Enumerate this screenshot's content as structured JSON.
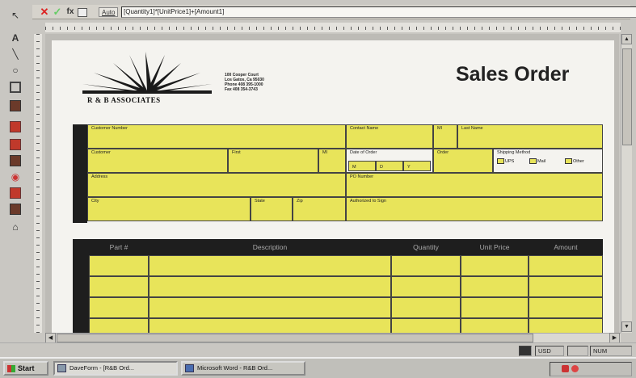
{
  "formula_bar": {
    "cancel_icon": "cancel-x",
    "ok_icon": "check",
    "function_label": "fx",
    "auto_label": "Auto",
    "formula": "[Quantity1]*[UnitPrice1]+[Amount1]"
  },
  "company": {
    "name": "R & B ASSOCIATES",
    "address_lines": [
      "100 Cooper Court",
      "Los Gatos, Ca 95030",
      "Phone 408 395-1000",
      "Fax 408 354-3743"
    ]
  },
  "document": {
    "title": "Sales Order"
  },
  "form": {
    "customer_number": "Customer Number",
    "contact_name": "Contact Name",
    "mi_1": "MI",
    "last_name": "Last Name",
    "customer": "Customer",
    "first": "First",
    "mi_2": "MI",
    "date_of_order": "Date of Order",
    "date_parts": [
      "M",
      "D",
      "Y"
    ],
    "order": "Order",
    "shipping_method": "Shipping Method",
    "shipping_options": [
      "UPS",
      "Mail",
      "Other"
    ],
    "address": "Address",
    "po_number": "PO Number",
    "city": "City",
    "state": "State",
    "zip": "Zip",
    "authorized": "Authorized to Sign"
  },
  "table": {
    "headers": [
      "Part #",
      "Description",
      "Quantity",
      "Unit Price",
      "Amount"
    ],
    "rows": 4
  },
  "status": {
    "usd": "USD",
    "num": "NUM"
  },
  "taskbar": {
    "start": "Start",
    "tasks": [
      "DaveForm - [R&B Ord...",
      "Microsoft Word - R&B Ord..."
    ]
  },
  "colors": {
    "field_yellow": "#e8e45a",
    "dark_band": "#1e1e1e",
    "page": "#f4f3ef",
    "cancel_red": "#d22222",
    "ok_green": "#66cc66"
  }
}
